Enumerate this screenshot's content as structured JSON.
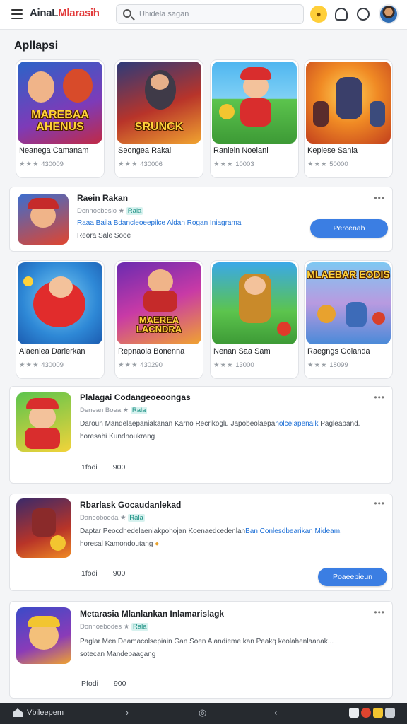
{
  "header": {
    "brand_part1": "AinaL",
    "brand_part2": "Mlarasih",
    "search_placeholder": "Uhidela sagan"
  },
  "section_title": "Apllapsi",
  "top_apps": [
    {
      "name": "Neanega Camanam",
      "meta": "430009",
      "art": "MAREBAA AHENUS"
    },
    {
      "name": "Seongea Rakall",
      "meta": "430006",
      "art": "SRUNCK"
    },
    {
      "name": "Ranlein Noelanl",
      "meta": "10003",
      "art": ""
    },
    {
      "name": "Keplese Sanla",
      "meta": "50000",
      "art": ""
    }
  ],
  "featured": {
    "title": "Raein Rakan",
    "sub_prefix": "Dennoebeslo",
    "sub_badge": "Rala",
    "desc_link": "Raaa Baila Bdancleoeepilce Aldan Rogan Iniagramal",
    "desc_tail": "Reora Sale Sooe",
    "button": "Percenab"
  },
  "second_apps": [
    {
      "name": "Alaenlea Darlerkan",
      "meta": "430009",
      "art": ""
    },
    {
      "name": "Repnaola Bonenna",
      "meta": "430290",
      "art": "MAEREA LACNDRA"
    },
    {
      "name": "Nenan Saa Sam",
      "meta": "13000",
      "art": ""
    },
    {
      "name": "Raegngs Oolanda",
      "meta": "18099",
      "art": "MLAEBAR EODIS"
    }
  ],
  "list_rows": [
    {
      "title": "Plalagai Codangeoeoongas",
      "sub_prefix": "Denean Boea",
      "sub_badge": "Rala",
      "desc1": "Daroun Mandelaepaniakanan Karno Recrikoglu Japobeolaepa",
      "desc1_link": "nolcelapenaik",
      "desc1_tail": "Pagleapand.",
      "desc2": "horesahi Kundnoukrang",
      "stat1": "1fodi",
      "stat2": "900",
      "button": ""
    },
    {
      "title": "Rbarlask Gocaudanlekad",
      "sub_prefix": "Daneoboeda",
      "sub_badge": "Rala",
      "desc1": "Daptar Peocdhedelaeniakpohojan Koenaedcedenlan",
      "desc1_link": "Ban Conlesdbearikan Mideam,",
      "desc1_tail": "",
      "desc2": "horesal Kamondoutang",
      "stat1": "1fodi",
      "stat2": "900",
      "button": "Poaeebieun"
    },
    {
      "title": "Metarasia Mlanlankan Inlamarislagk",
      "sub_prefix": "Donnoebodes",
      "sub_badge": "Rala",
      "desc1": "Paglar Men Deamacolsepiain Gan Soen Alandieme kan Peakq keolahenlaanak...",
      "desc1_link": "",
      "desc1_tail": "",
      "desc2": "sotecan Mandebaagang",
      "stat1": "Pfodi",
      "stat2": "900",
      "button": ""
    }
  ],
  "taskbar": {
    "label": "Vbileepem"
  },
  "colors": {
    "accent": "#3b7ee3",
    "brand_red": "#e23b3b",
    "badge_bg": "#d7f2ef",
    "link": "#1d6fd6"
  },
  "icons": [
    "hamburger-icon",
    "search-icon",
    "coin-icon",
    "bell-icon",
    "chat-icon",
    "more-icon",
    "home-icon"
  ]
}
